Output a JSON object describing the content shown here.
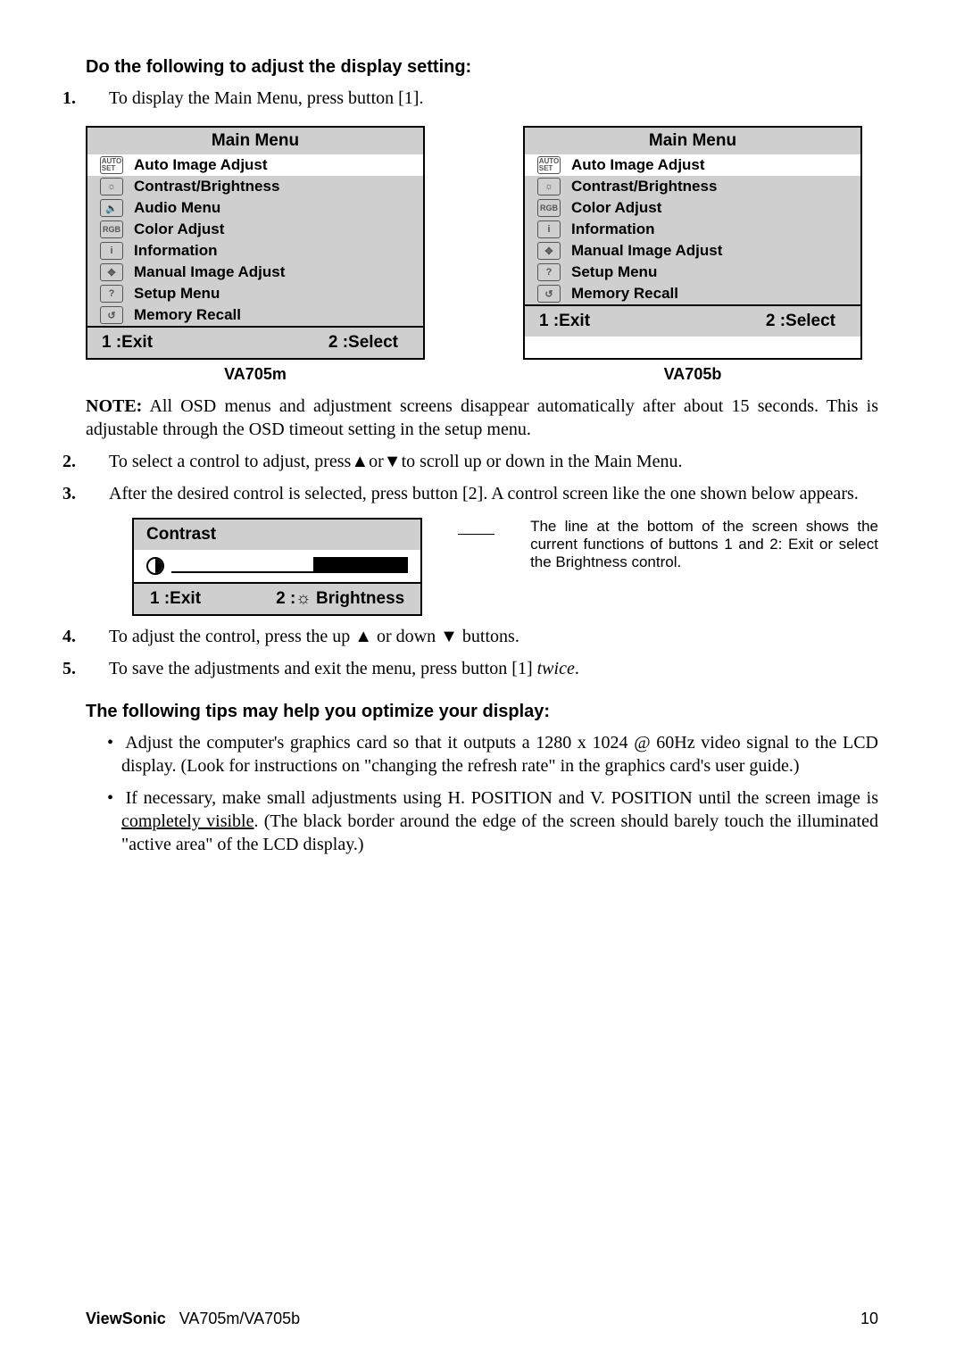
{
  "heading1": "Do the following to adjust the display setting:",
  "step1_num": "1.",
  "step1": "To display the Main Menu, press button [1].",
  "menuA": {
    "title": "Main Menu",
    "items": [
      {
        "icon": "AUTO SET",
        "label": "Auto Image Adjust"
      },
      {
        "icon": "☼",
        "label": "Contrast/Brightness"
      },
      {
        "icon": "🔈",
        "label": "Audio Menu"
      },
      {
        "icon": "RGB",
        "label": "Color Adjust"
      },
      {
        "icon": "i",
        "label": "Information"
      },
      {
        "icon": "✥",
        "label": "Manual Image Adjust"
      },
      {
        "icon": "?",
        "label": "Setup Menu"
      },
      {
        "icon": "↺",
        "label": "Memory Recall"
      }
    ],
    "footerL": "1 :Exit",
    "footerR": "2 :Select",
    "caption": "VA705m"
  },
  "menuB": {
    "title": "Main Menu",
    "items": [
      {
        "icon": "AUTO SET",
        "label": "Auto Image Adjust"
      },
      {
        "icon": "☼",
        "label": "Contrast/Brightness"
      },
      {
        "icon": "RGB",
        "label": "Color Adjust"
      },
      {
        "icon": "i",
        "label": "Information"
      },
      {
        "icon": "✥",
        "label": "Manual Image Adjust"
      },
      {
        "icon": "?",
        "label": "Setup Menu"
      },
      {
        "icon": "↺",
        "label": "Memory Recall"
      }
    ],
    "footerL": "1 :Exit",
    "footerR": "2 :Select",
    "caption": "VA705b"
  },
  "note": {
    "lead": "NOTE:",
    "text": " All OSD menus and adjustment screens disappear automatically after about 15 seconds. This is adjustable through the OSD timeout setting in the setup menu."
  },
  "step2_num": "2.",
  "step2_a": "To select a control to adjust, press",
  "step2_b": "or",
  "step2_c": "to scroll up or down in the Main Menu.",
  "step3_num": "3.",
  "step3": "After the desired control is selected, press button [2]. A control screen like the one shown below appears.",
  "ctrl": {
    "title": "Contrast",
    "footerL": "1 :Exit",
    "footerR": "2 :☼ Brightness"
  },
  "ctrlnote": "The line at the bottom of the screen shows the current functions of buttons 1 and 2: Exit or select the Brightness control.",
  "step4_num": "4.",
  "step4_a": "To adjust the control, press the up ",
  "step4_b": " or down ",
  "step4_c": " buttons.",
  "step5_num": "5.",
  "step5_a": "To save the adjustments and exit the menu, press button [1] ",
  "step5_b": "twice",
  "step5_c": ".",
  "heading2": "The following tips may help you optimize your display:",
  "bullet1": "Adjust the computer's graphics card so that it outputs a 1280 x 1024 @ 60Hz video signal to the LCD display. (Look for instructions on \"changing the refresh rate\" in the graphics card's user guide.)",
  "bullet2_a": "If necessary, make small adjustments using H. POSITION and V. POSITION until the screen image is ",
  "bullet2_b": "completely visible",
  "bullet2_c": ". (The black border around the edge of the screen should barely touch the illuminated \"active area\" of the LCD display.)",
  "footer": {
    "brand": "ViewSonic",
    "product": "VA705m/VA705b",
    "page": "10"
  }
}
